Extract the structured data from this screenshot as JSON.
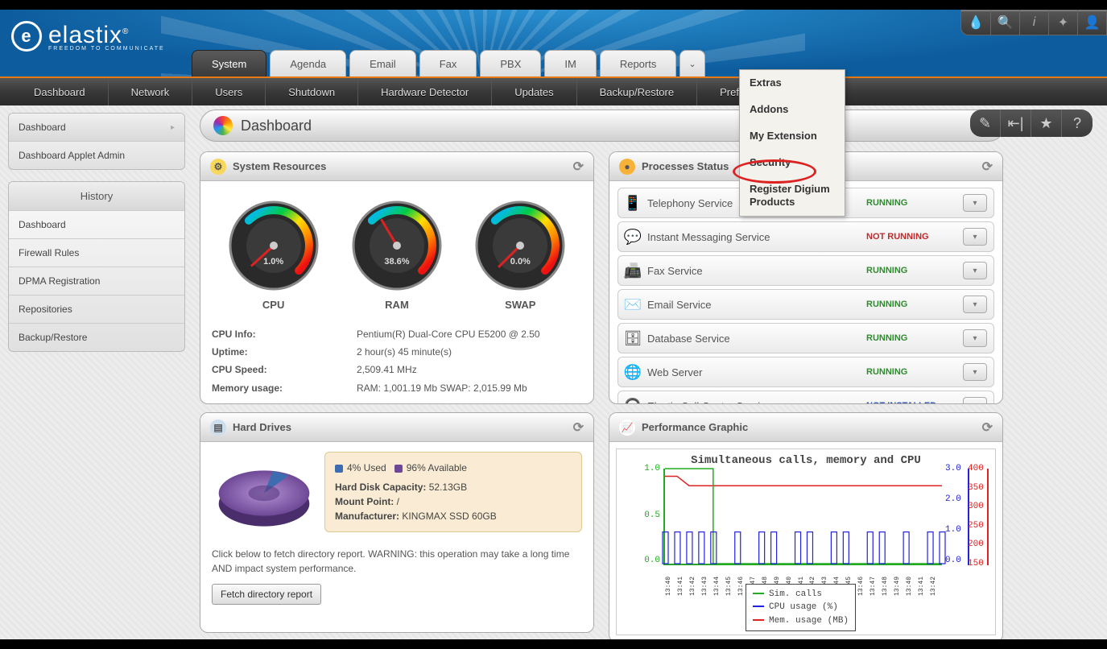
{
  "logo": {
    "text": "elastix",
    "tagline": "FREEDOM TO COMMUNICATE",
    "trademark": "®"
  },
  "top_icons": [
    "droplet-icon",
    "search-icon",
    "info-icon",
    "puzzle-icon",
    "user-icon"
  ],
  "tabs": [
    {
      "label": "System",
      "active": true
    },
    {
      "label": "Agenda",
      "active": false
    },
    {
      "label": "Email",
      "active": false
    },
    {
      "label": "Fax",
      "active": false
    },
    {
      "label": "PBX",
      "active": false
    },
    {
      "label": "IM",
      "active": false
    },
    {
      "label": "Reports",
      "active": false
    }
  ],
  "tabs_more_glyph": "⌄",
  "subnav": [
    "Dashboard",
    "Network",
    "Users",
    "Shutdown",
    "Hardware Detector",
    "Updates",
    "Backup/Restore",
    "Preferences"
  ],
  "sidebar": {
    "box1": [
      {
        "label": "Dashboard",
        "active": true,
        "arrow": "▸"
      },
      {
        "label": "Dashboard Applet Admin",
        "active": false
      }
    ],
    "history_heading": "History",
    "history": [
      "Dashboard",
      "Firewall Rules",
      "DPMA Registration",
      "Repositories",
      "Backup/Restore"
    ]
  },
  "page_title": "Dashboard",
  "page_actions": [
    "edit-icon",
    "collapse-icon",
    "star-icon",
    "help-icon"
  ],
  "dropdown": {
    "items": [
      "Extras",
      "Addons",
      "My Extension",
      "Security",
      "Register Digium Products"
    ],
    "highlighted_index": 3
  },
  "panels": {
    "sysres": {
      "title": "System Resources",
      "gauges": [
        {
          "name": "CPU",
          "pct": "1.0%",
          "value": 1.0
        },
        {
          "name": "RAM",
          "pct": "38.6%",
          "value": 38.6
        },
        {
          "name": "SWAP",
          "pct": "0.0%",
          "value": 0.0
        }
      ],
      "info": [
        {
          "k": "CPU Info:",
          "v": "Pentium(R) Dual-Core CPU E5200 @ 2.50"
        },
        {
          "k": "Uptime:",
          "v": "2 hour(s) 45 minute(s)"
        },
        {
          "k": "CPU Speed:",
          "v": "2,509.41 MHz"
        },
        {
          "k": "Memory usage:",
          "v": "RAM: 1,001.19 Mb SWAP: 2,015.99 Mb"
        }
      ]
    },
    "procs": {
      "title": "Processes Status",
      "rows": [
        {
          "icon": "📱",
          "name": "Telephony Service",
          "status": "RUNNING",
          "cls": "running"
        },
        {
          "icon": "💬",
          "name": "Instant Messaging Service",
          "status": "NOT RUNNING",
          "cls": "not-running"
        },
        {
          "icon": "📠",
          "name": "Fax Service",
          "status": "RUNNING",
          "cls": "running"
        },
        {
          "icon": "✉️",
          "name": "Email Service",
          "status": "RUNNING",
          "cls": "running"
        },
        {
          "icon": "🗄",
          "name": "Database Service",
          "status": "RUNNING",
          "cls": "running"
        },
        {
          "icon": "🌐",
          "name": "Web Server",
          "status": "RUNNING",
          "cls": "running"
        },
        {
          "icon": "🎧",
          "name": "Elastix Call Center Service",
          "status": "NOT INSTALLED",
          "cls": "not-installed"
        }
      ]
    },
    "hd": {
      "title": "Hard Drives",
      "used_label": "4% Used",
      "avail_label": "96% Available",
      "capacity_k": "Hard Disk Capacity:",
      "capacity_v": "52.13GB",
      "mount_k": "Mount Point:",
      "mount_v": "/",
      "manu_k": "Manufacturer:",
      "manu_v": "KINGMAX SSD 60GB",
      "warning": "Click below to fetch directory report. WARNING: this operation may take a long time AND impact system performance.",
      "button": "Fetch directory report",
      "used_pct": 4,
      "avail_pct": 96
    },
    "perf": {
      "title": "Performance Graphic",
      "chart_title": "Simultaneous calls, memory and CPU",
      "left_axis": [
        "1.0",
        "0.5",
        "0.0"
      ],
      "right_axis1": [
        "3.0",
        "2.0",
        "1.0",
        "0.0"
      ],
      "right_axis2": [
        "400",
        "350",
        "300",
        "250",
        "200",
        "150"
      ],
      "legend": [
        {
          "color": "#2a2",
          "label": "Sim. calls"
        },
        {
          "color": "#22d",
          "label": "CPU usage (%)"
        },
        {
          "color": "#d22",
          "label": "Mem. usage (MB)"
        }
      ]
    }
  },
  "chart_data": {
    "type": "line",
    "title": "Simultaneous calls, memory and CPU",
    "x_note": "timestamps rendered as dense rotated tick labels (24 samples)",
    "left_axis": {
      "label": "Sim. calls",
      "range": [
        0.0,
        1.0
      ],
      "color": "#22aa22"
    },
    "right_axis_1": {
      "label": "CPU usage (%)",
      "range": [
        0.0,
        3.0
      ],
      "color": "#2222dd"
    },
    "right_axis_2": {
      "label": "Mem. usage (MB)",
      "range": [
        150,
        400
      ],
      "color": "#dd2222"
    },
    "series": [
      {
        "name": "Sim. calls",
        "axis": "left",
        "values": [
          1,
          1,
          1,
          1,
          0,
          0,
          0,
          0,
          0,
          0,
          0,
          0,
          0,
          0,
          0,
          0,
          0,
          0,
          0,
          0,
          0,
          0,
          0,
          0
        ]
      },
      {
        "name": "CPU usage (%)",
        "axis": "right1",
        "values": [
          1,
          1,
          1,
          1,
          1,
          0,
          1,
          0,
          1,
          1,
          0,
          1,
          1,
          0,
          1,
          1,
          0,
          1,
          1,
          0,
          1,
          0,
          1,
          1
        ]
      },
      {
        "name": "Mem. usage (MB)",
        "axis": "right2",
        "values": [
          380,
          380,
          355,
          355,
          355,
          355,
          355,
          355,
          355,
          355,
          355,
          355,
          355,
          355,
          355,
          355,
          355,
          355,
          355,
          355,
          355,
          355,
          355,
          355
        ]
      }
    ]
  }
}
